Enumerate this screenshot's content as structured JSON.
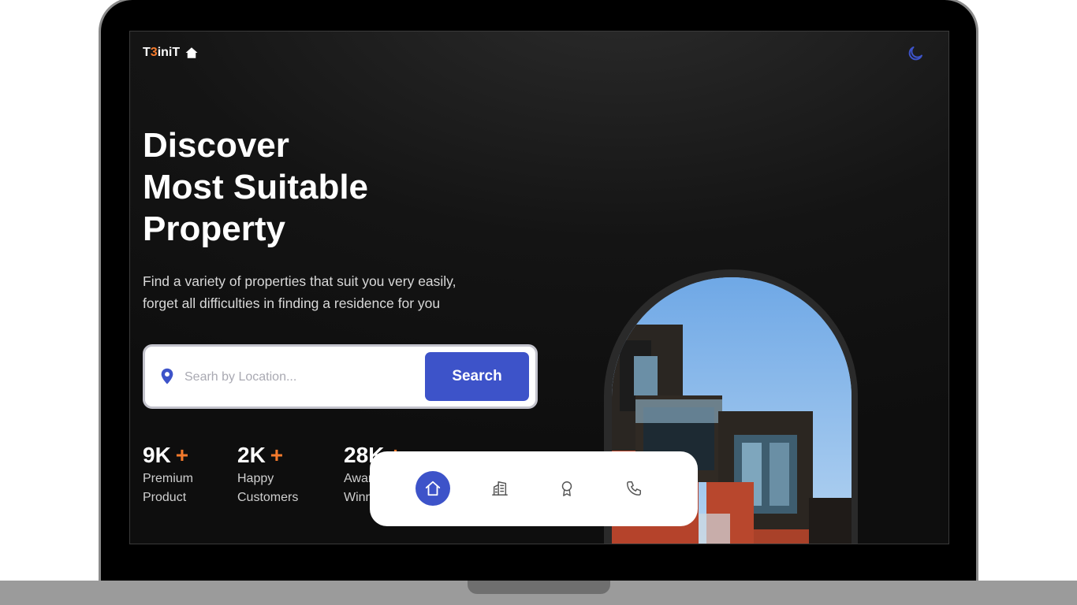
{
  "brand": {
    "prefix": "T",
    "accent": "3",
    "suffix": "iniT",
    "icon": "house-icon"
  },
  "theme_toggle": {
    "icon": "moon-icon",
    "color": "#3d53c9"
  },
  "hero": {
    "title": [
      "Discover",
      "Most Suitable",
      "Property"
    ],
    "subtitle": [
      "Find a variety of properties that suit you very easily,",
      "forget all difficulties in finding a residence for you"
    ]
  },
  "search": {
    "placeholder": "Searh by Location...",
    "value": "",
    "button_label": "Search",
    "icon": "location-pin-icon"
  },
  "stats": [
    {
      "value": "9K",
      "plus": "+",
      "label": [
        "Premium",
        "Product"
      ]
    },
    {
      "value": "2K",
      "plus": "+",
      "label": [
        "Happy",
        "Customers"
      ]
    },
    {
      "value": "28K",
      "plus": "+",
      "label": [
        "Award",
        "Winning"
      ]
    }
  ],
  "bottom_nav": [
    {
      "icon": "home-icon",
      "active": true
    },
    {
      "icon": "building-icon",
      "active": false
    },
    {
      "icon": "award-icon",
      "active": false
    },
    {
      "icon": "phone-icon",
      "active": false
    }
  ],
  "colors": {
    "accent": "#3d53c9",
    "highlight": "#f47a2c",
    "background": "#141414"
  }
}
